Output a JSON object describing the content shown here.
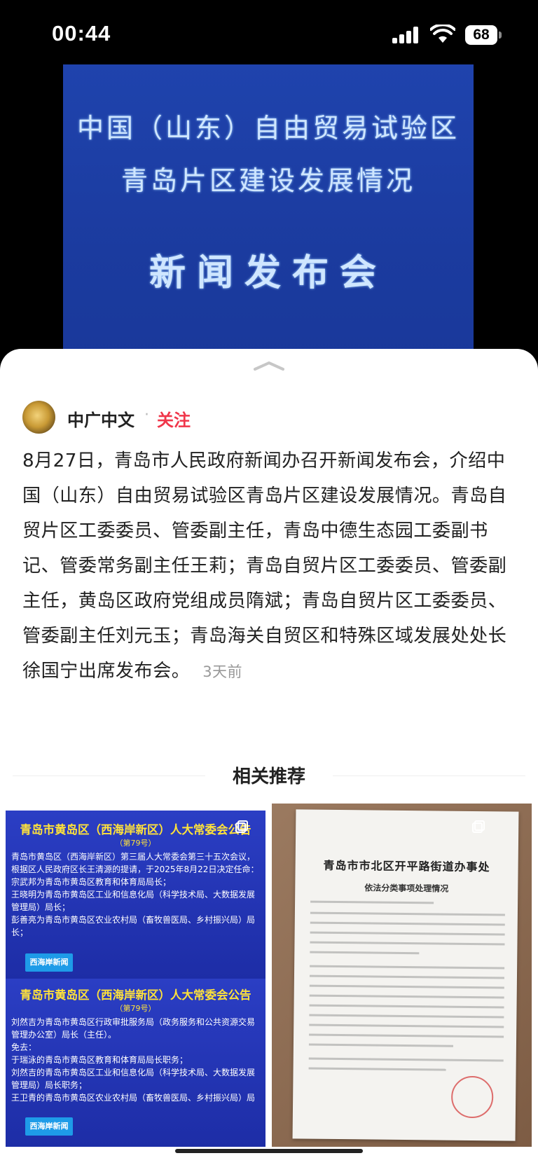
{
  "status_bar": {
    "time": "00:44",
    "battery": "68"
  },
  "video": {
    "line1": "中国（山东）自由贸易试验区",
    "line2": "青岛片区建设发展情况",
    "line3": "新闻发布会"
  },
  "author": {
    "name": "中广中文",
    "separator": "·",
    "follow_label": "关注"
  },
  "post": {
    "text": "8月27日，青岛市人民政府新闻办召开新闻发布会，介绍中国（山东）自由贸易试验区青岛片区建设发展情况。青岛自贸片区工委委员、管委副主任，青岛中德生态园工委副书记、管委常务副主任王莉；青岛自贸片区工委委员、管委副主任，黄岛区政府党组成员隋斌；青岛自贸片区工委委员、管委副主任刘元玉；青岛海关自贸区和特殊区域发展处处长徐国宁出席发布会。",
    "time": "3天前"
  },
  "related": {
    "title": "相关推荐",
    "left_card": {
      "panel1": {
        "title": "青岛市黄岛区（西海岸新区）人大常委会公告",
        "number": "（第79号）",
        "lines": [
          "青岛市黄岛区（西海岸新区）第三届人大常委会第三十五次会议，",
          "根据区人民政府区长王清源的提请，于2025年8月22日决定任命：",
          "宗武邦为青岛市黄岛区教育和体育局局长；",
          "王晓明为青岛市黄岛区工业和信息化局（科学技术局、大数据发展",
          "管理局）局长；",
          "彭善亮为青岛市黄岛区农业农村局（畜牧兽医局、乡村振兴局）局",
          "长；"
        ],
        "logo": "西海岸新闻"
      },
      "panel2": {
        "title": "青岛市黄岛区（西海岸新区）人大常委会公告",
        "number": "（第79号）",
        "lines": [
          "刘然吉为青岛市黄岛区行政审批服务局（政务服务和公共资源交易",
          "管理办公室）局长（主任）。",
          "免去：",
          "于瑞泳的青岛市黄岛区教育和体育局局长职务；",
          "刘然吉的青岛市黄岛区工业和信息化局（科学技术局、大数据发展",
          "管理局）局长职务；",
          "王卫青的青岛市黄岛区农业农村局（畜牧兽医局、乡村振兴局）局"
        ],
        "logo": "西海岸新闻"
      }
    },
    "right_card": {
      "doc_title": "青岛市市北区开平路街道办事处",
      "doc_subtitle": "依法分类事项处理情况"
    }
  },
  "colors": {
    "follow": "#f0364a",
    "video_bg": "#1f43ad",
    "panel_title": "#ffe23a"
  }
}
